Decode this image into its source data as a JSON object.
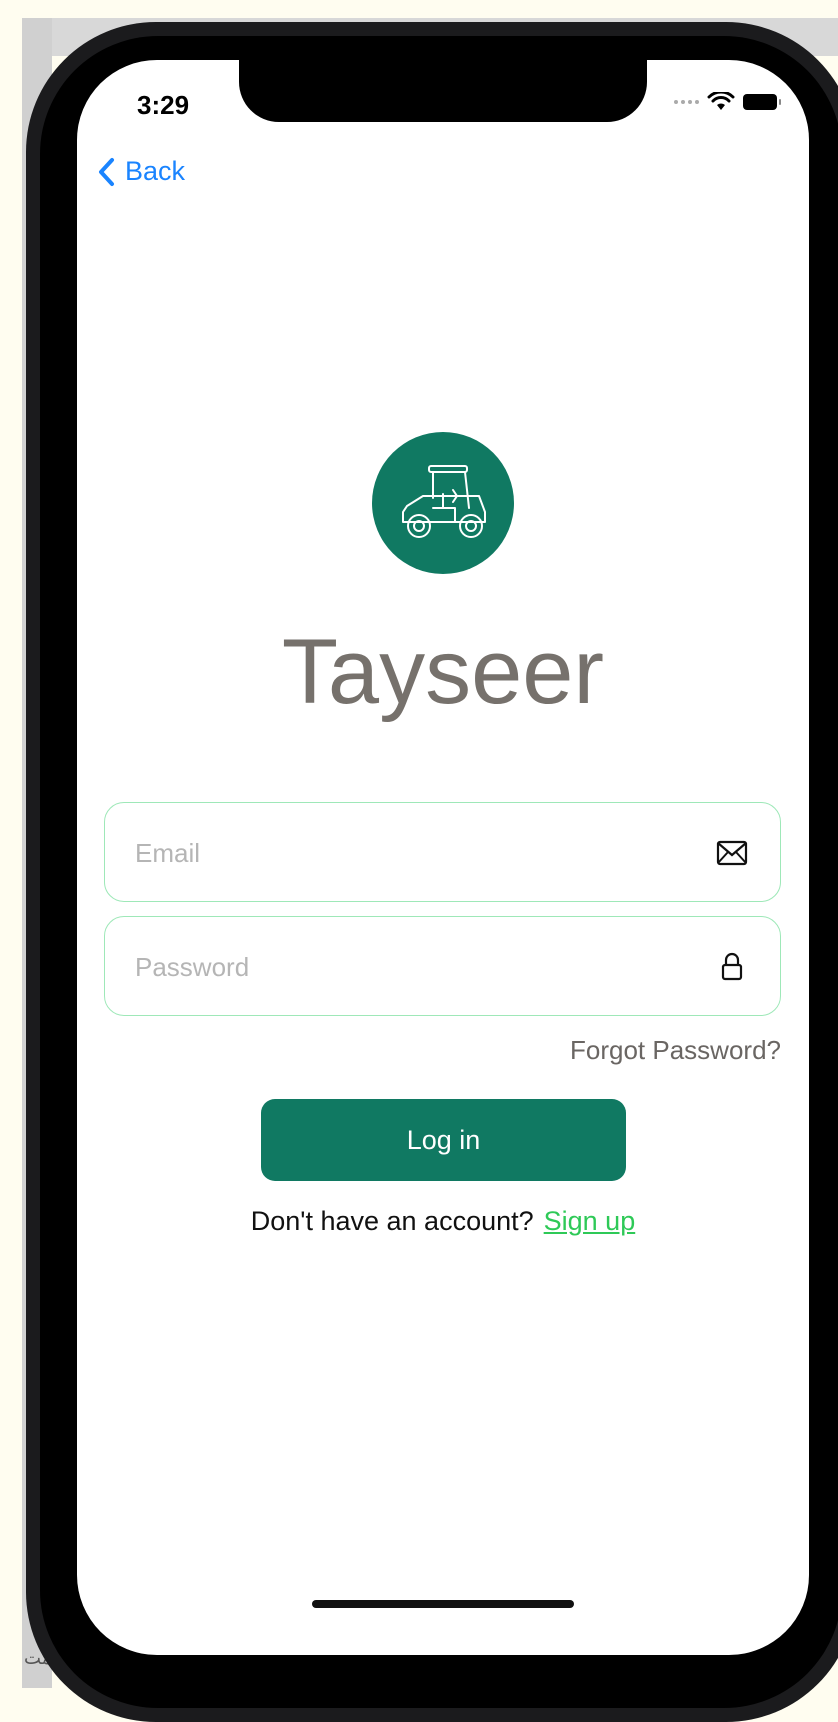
{
  "status_bar": {
    "time": "3:29",
    "icons": [
      "signal-dots-icon",
      "wifi-icon",
      "battery-icon"
    ]
  },
  "nav": {
    "back_label": "Back",
    "back_icon": "chevron-left-icon"
  },
  "brand": {
    "name": "Tayseer",
    "logo_icon": "golf-cart-icon",
    "logo_color": "#107962"
  },
  "login_form": {
    "email_placeholder": "Email",
    "email_value": "",
    "email_icon": "envelope-icon",
    "password_placeholder": "Password",
    "password_value": "",
    "password_icon": "lock-icon",
    "forgot_password_label": "Forgot Password?",
    "login_button_label": "Log in",
    "signup_prompt": "Don't have an account?",
    "signup_link_label": "Sign up"
  },
  "colors": {
    "accent": "#107962",
    "link_blue": "#1a84ff",
    "signup_green": "#2ec957",
    "field_border": "#9ee8b8",
    "title_gray": "#76716c"
  },
  "background": {
    "corner_text": "المت"
  }
}
